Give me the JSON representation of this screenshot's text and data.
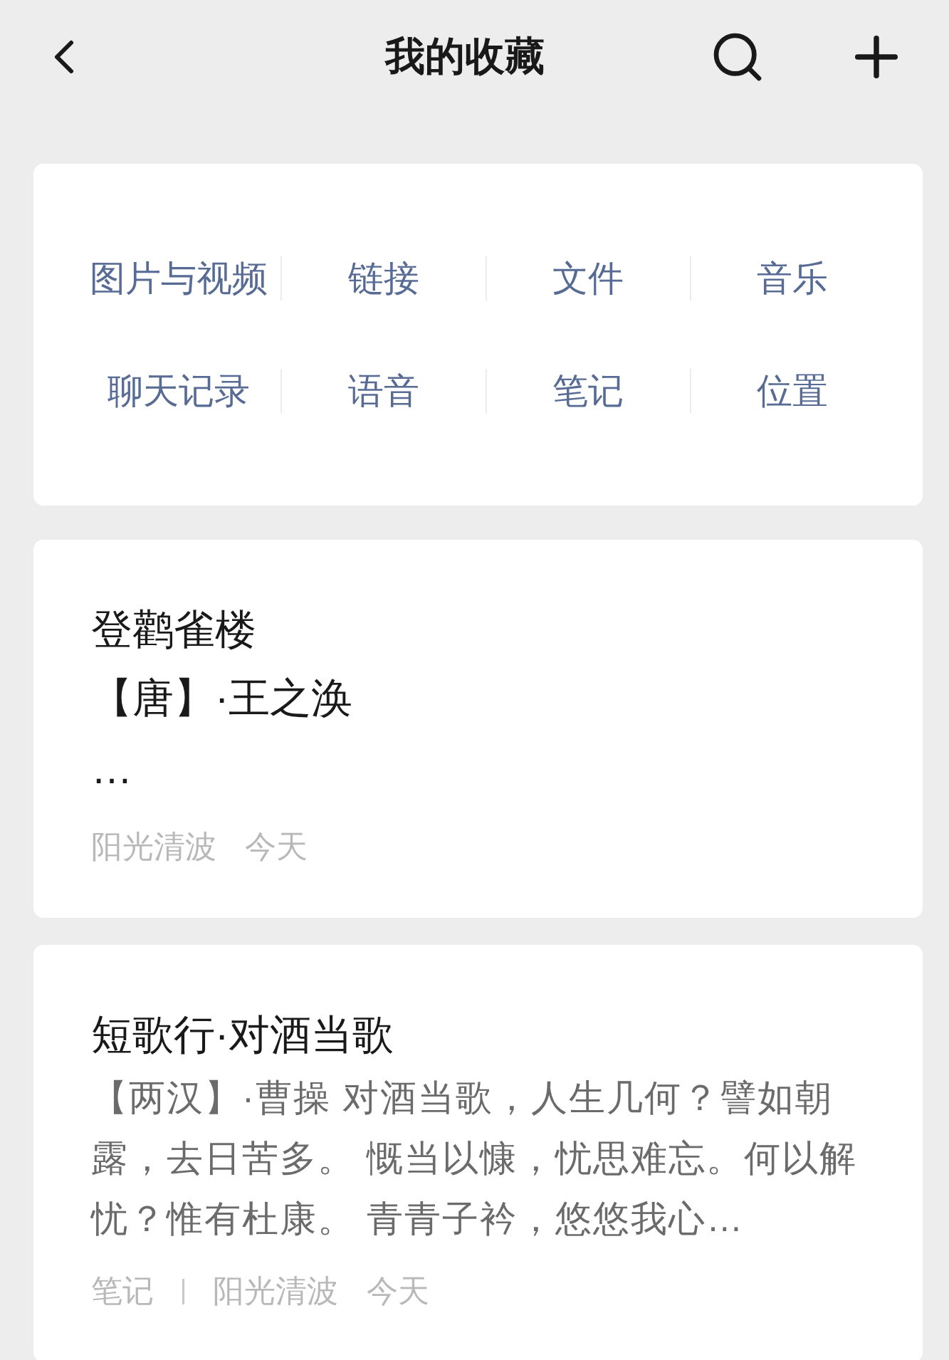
{
  "header": {
    "title": "我的收藏"
  },
  "category_rows": [
    {
      "items": [
        "图片与视频",
        "链接",
        "文件",
        "音乐"
      ]
    },
    {
      "items": [
        "聊天记录",
        "语音",
        "笔记",
        "位置"
      ]
    }
  ],
  "favorites": [
    {
      "kind": "heading",
      "title": "登鹳雀楼",
      "body": [
        "【唐】·王之涣",
        "…"
      ],
      "source": "阳光清波",
      "time": "今天"
    },
    {
      "kind": "excerpt",
      "title": "短歌行·对酒当歌",
      "body": [
        "【两汉】·曹操  对酒当歌，人生几何？譬如朝露，去日苦多。 慨当以慷，忧思难忘。何以解忧？惟有杜康。 青青子衿，悠悠我心…"
      ],
      "tag": "笔记",
      "source": "阳光清波",
      "time": "今天"
    }
  ]
}
